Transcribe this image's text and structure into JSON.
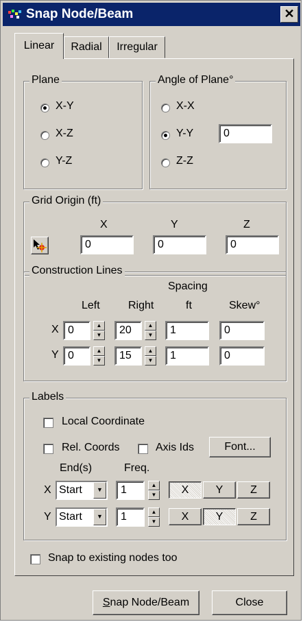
{
  "window": {
    "title": "Snap Node/Beam",
    "close_glyph": "✕"
  },
  "tabs": [
    {
      "label": "Linear"
    },
    {
      "label": "Radial"
    },
    {
      "label": "Irregular"
    }
  ],
  "plane": {
    "title": "Plane",
    "options": [
      "X-Y",
      "X-Z",
      "Y-Z"
    ],
    "selected": "X-Y"
  },
  "angle": {
    "title": "Angle of Plane°",
    "options": [
      "X-X",
      "Y-Y",
      "Z-Z"
    ],
    "selected": "Y-Y",
    "value": "0"
  },
  "grid_origin": {
    "title": "Grid Origin (ft)",
    "x_label": "X",
    "y_label": "Y",
    "z_label": "Z",
    "x": "0",
    "y": "0",
    "z": "0",
    "pick_icon": "pick-point-icon"
  },
  "construction": {
    "title": "Construction Lines",
    "col_left": "Left",
    "col_right": "Right",
    "col_spacing": "Spacing",
    "col_spacing_unit": "ft",
    "col_skew": "Skew°",
    "rows": [
      {
        "label": "X",
        "left": "0",
        "right": "20",
        "spacing": "1",
        "skew": "0"
      },
      {
        "label": "Y",
        "left": "0",
        "right": "15",
        "spacing": "1",
        "skew": "0"
      }
    ]
  },
  "labels": {
    "title": "Labels",
    "local_coordinate": "Local Coordinate",
    "rel_coords": "Rel. Coords",
    "axis_ids": "Axis Ids",
    "font_button": "Font...",
    "col_ends": "End(s)",
    "col_freq": "Freq.",
    "rows": [
      {
        "label": "X",
        "ends": "Start",
        "freq": "1",
        "axis_buttons": [
          "X",
          "Y",
          "Z"
        ],
        "pressed": "X"
      },
      {
        "label": "Y",
        "ends": "Start",
        "freq": "1",
        "axis_buttons": [
          "X",
          "Y",
          "Z"
        ],
        "pressed": "Y"
      }
    ]
  },
  "snap_existing": "Snap to existing nodes too",
  "buttons": {
    "snap_prefix": "S",
    "snap_rest": "nap Node/Beam",
    "close": "Close"
  }
}
